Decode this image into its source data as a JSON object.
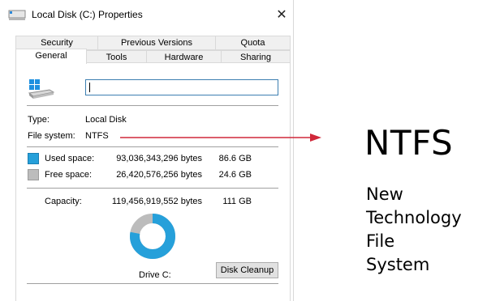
{
  "window": {
    "title": "Local Disk (C:) Properties",
    "close_glyph": "✕",
    "icon": "drive-icon"
  },
  "tabs_row1": [
    {
      "label": "Security"
    },
    {
      "label": "Previous Versions"
    },
    {
      "label": "Quota"
    }
  ],
  "tabs_row2": [
    {
      "label": "General",
      "active": true
    },
    {
      "label": "Tools"
    },
    {
      "label": "Hardware"
    },
    {
      "label": "Sharing"
    }
  ],
  "general": {
    "drive_name_value": "",
    "type_label": "Type:",
    "type_value": "Local Disk",
    "fs_label": "File system:",
    "fs_value": "NTFS",
    "used_label": "Used space:",
    "used_bytes": "93,036,343,296 bytes",
    "used_gb": "86.6 GB",
    "free_label": "Free space:",
    "free_bytes": "26,420,576,256 bytes",
    "free_gb": "24.6 GB",
    "capacity_label": "Capacity:",
    "capacity_bytes": "119,456,919,552 bytes",
    "capacity_gb": "111 GB",
    "drive_label": "Drive C:",
    "disk_cleanup_label": "Disk Cleanup",
    "used_fraction": 0.779
  },
  "colors": {
    "used": "#26a0da",
    "free": "#bcbcbc",
    "arrow": "#d0283a"
  },
  "annotation": {
    "title": "NTFS",
    "lines": [
      "New",
      "Technology",
      "File",
      "System"
    ]
  }
}
